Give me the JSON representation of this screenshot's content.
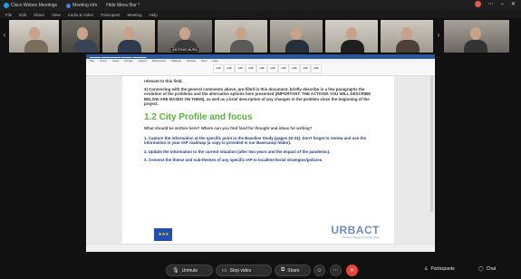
{
  "titlebar": {
    "app_name": "Cisco Webex Meetings",
    "meeting_info": "Meeting info",
    "hide_menu": "Hide Menu Bar ^"
  },
  "menubar": [
    "File",
    "Edit",
    "Share",
    "View",
    "Audio & Video",
    "Participant",
    "Meeting",
    "Help"
  ],
  "participants": [
    {
      "name": ""
    },
    {
      "name": ""
    },
    {
      "name": ""
    },
    {
      "name": "ANTONIO MURA"
    },
    {
      "name": ""
    },
    {
      "name": ""
    },
    {
      "name": ""
    },
    {
      "name": ""
    },
    {
      "name": ""
    }
  ],
  "word": {
    "title": "Word document — shared screen",
    "tabs": [
      "File",
      "Home",
      "Insert",
      "Design",
      "Layout",
      "References",
      "Mailings",
      "Review",
      "View",
      "Help"
    ],
    "paragraphs": {
      "p1": "relevant to this field.",
      "p2_num": "3)",
      "p2": "Connecting with the general comments above, pre-filled in this document, briefly describe in a few paragraphs the evolution of the problems and the alternative options here presented (IMPORTANT: THE ACTIONS YOU WILL DESCRIBE BELOW ARE BASED ON THEM), as well as a brief description of any changes in the problem since the beginning of the project.",
      "heading": "1.2 City Profile and focus",
      "question": "What should be written here? Where can you find food for thought and ideas for writing?",
      "item1": "1. Capture the information at the specific point in the Baseline Study (pages 20-33). Don't forget to review and use the information in your IAP roadmap (a copy is provided in our Basecamp folder).",
      "item2": "2. Update the information to the current situation (after two years and the impact of the pandemic).",
      "item3": "3. Connect the theme and sub-themes of any specific IAP to local/territorial strategies/policies."
    },
    "logo": {
      "urbact": "URBACT",
      "tagline": "Driving change for better cities"
    }
  },
  "controls": {
    "unmute": "Unmute",
    "stop_video": "Stop video",
    "share": "Share",
    "participants": "Participants",
    "chat": "Chat"
  },
  "colors": {
    "accent": "#5ab33a",
    "end_call": "#e8463b",
    "word_blue": "#2b579a"
  }
}
